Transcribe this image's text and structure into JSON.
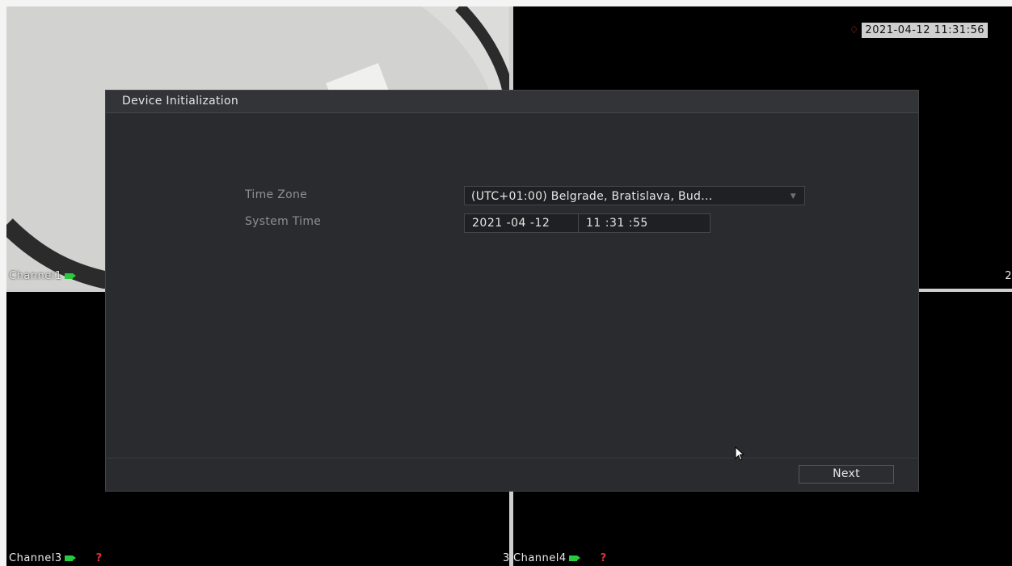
{
  "dialog": {
    "title": "Device Initialization",
    "time_zone_label": "Time Zone",
    "time_zone_value": "(UTC+01:00) Belgrade, Bratislava, Bud...",
    "system_time_label": "System Time",
    "date_value": "2021 -04 -12",
    "time_value": "11 :31 :55",
    "next_label": "Next"
  },
  "osd": {
    "timestamp": "2021-04-12 11:31:56",
    "alarm_icon": "bell-icon",
    "alarm_color": "#e03030"
  },
  "channels": [
    {
      "label": "Channel1",
      "status_icon": "camera-recording-icon"
    },
    {
      "label": "Channel3",
      "status_icon": "camera-recording-icon",
      "alert": "?"
    },
    {
      "label": "Channel4",
      "prefix": "3",
      "status_icon": "camera-recording-icon",
      "alert": "?"
    }
  ],
  "channel2_number_fragment": "2",
  "colors": {
    "dialog_bg": "#2a2b2e",
    "recording": "#27c93f",
    "alert": "#e03030"
  }
}
